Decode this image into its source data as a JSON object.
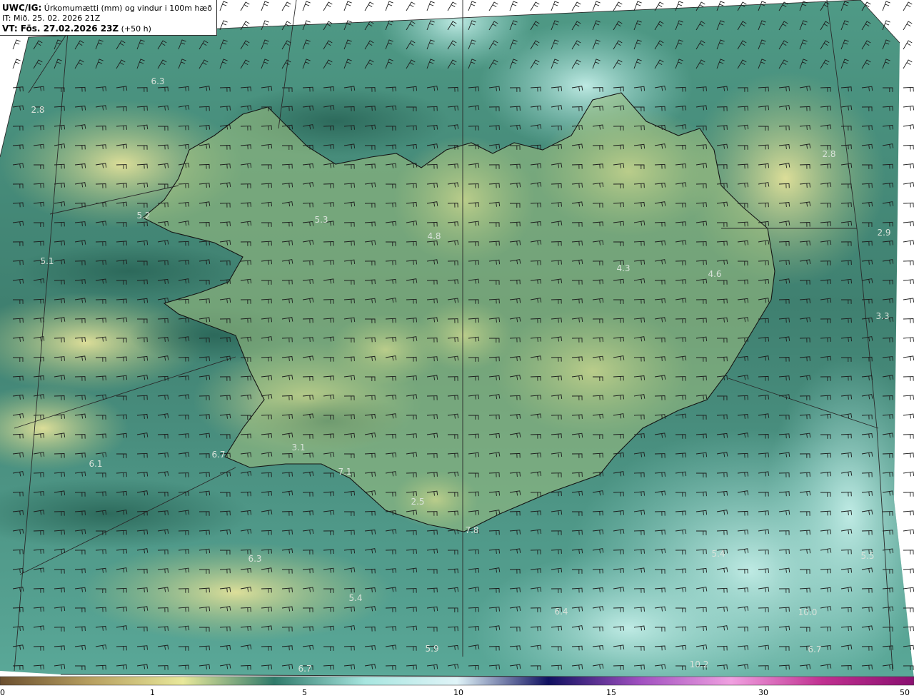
{
  "header": {
    "product": "UWC/IG:",
    "description": "Úrkomumætti (mm) og vindur i 100m hæð",
    "issue_time": "IT: Mið. 25. 02. 2026 21Z",
    "valid_label": "VT: Fös. 27.02.2026 23Z",
    "valid_offset": "(+50 h)"
  },
  "colors": {
    "sea_dark": "#2f6f60",
    "sea_mid": "#4a8c78",
    "land_yellow": "#d8d88a",
    "land_green": "#7fa86e",
    "pale_cyan": "#a9dcd4",
    "coast": "#1a1a1a",
    "grid": "#333333"
  },
  "colorbar": {
    "ticks": [
      "0",
      "1",
      "5",
      "10",
      "15",
      "30",
      "50"
    ],
    "stops": [
      "#6b4f2f",
      "#b8a060",
      "#e8e89a",
      "#2f7a6a",
      "#a8e6e0",
      "#e0f4f8",
      "#101060",
      "#a050c0",
      "#f0a0e0",
      "#c03090",
      "#8a1070"
    ]
  },
  "value_labels": [
    "6.3",
    "2.8",
    "5.2",
    "5.1",
    "5.3",
    "4.8",
    "4.3",
    "4.6",
    "2.8",
    "2.9",
    "3.3",
    "6.7",
    "6.1",
    "3.1",
    "7.1",
    "2.5",
    "7.8",
    "6.3",
    "5.4",
    "6.4",
    "5.9",
    "6.7",
    "5.4",
    "5.5",
    "10.0",
    "6.7",
    "10.2"
  ]
}
